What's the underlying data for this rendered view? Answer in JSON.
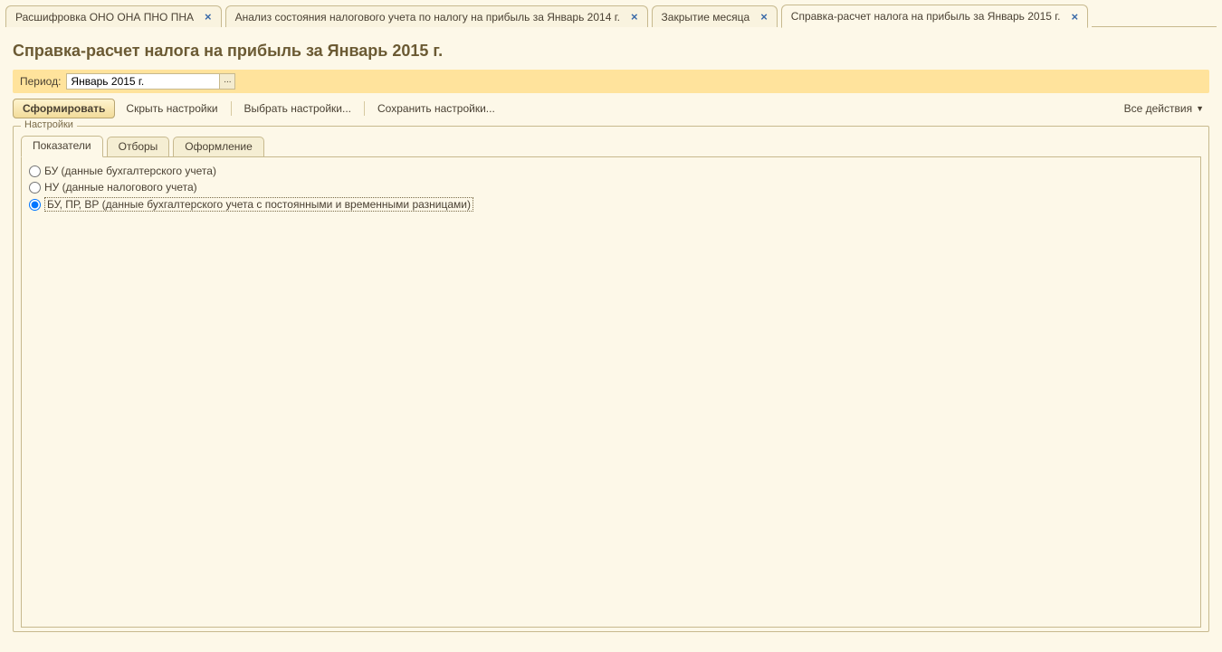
{
  "tabs": [
    {
      "label": "Расшифровка ОНО ОНА ПНО ПНА",
      "active": false
    },
    {
      "label": "Анализ состояния налогового учета по налогу на прибыль за Январь 2014 г.",
      "active": false
    },
    {
      "label": "Закрытие месяца",
      "active": false
    },
    {
      "label": "Справка-расчет налога на прибыль  за Январь 2015 г.",
      "active": true
    }
  ],
  "page_title": "Справка-расчет налога на прибыль  за Январь 2015 г.",
  "period": {
    "label": "Период:",
    "value": "Январь 2015 г."
  },
  "toolbar": {
    "form": "Сформировать",
    "hide_settings": "Скрыть настройки",
    "choose_settings": "Выбрать настройки...",
    "save_settings": "Сохранить настройки...",
    "all_actions": "Все действия"
  },
  "settings": {
    "legend": "Настройки",
    "tabs": [
      {
        "label": "Показатели",
        "active": true
      },
      {
        "label": "Отборы",
        "active": false
      },
      {
        "label": "Оформление",
        "active": false
      }
    ],
    "radios": [
      {
        "label": "БУ (данные бухгалтерского учета)",
        "checked": false
      },
      {
        "label": "НУ (данные налогового учета)",
        "checked": false
      },
      {
        "label": "БУ, ПР, ВР (данные бухгалтерского учета с постоянными и временными разницами)",
        "checked": true
      }
    ]
  }
}
